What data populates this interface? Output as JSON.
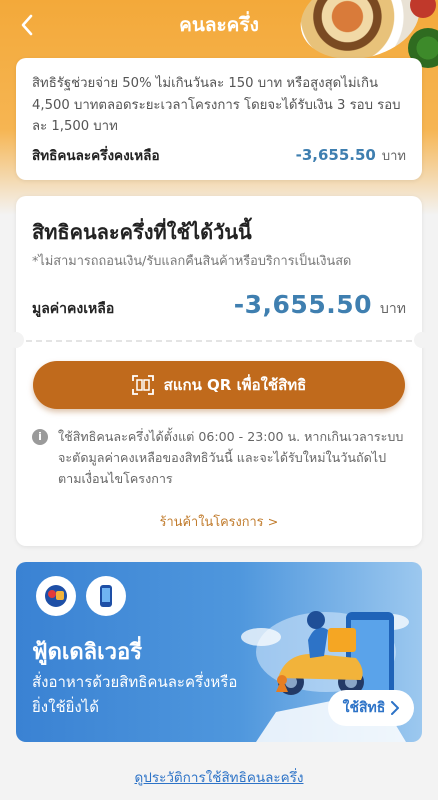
{
  "header": {
    "title": "คนละครึ่ง"
  },
  "info": {
    "description": "สิทธิรัฐช่วยจ่าย 50% ไม่เกินวันละ 150 บาท หรือสูงสุดไม่เกิน 4,500 บาทตลอดระยะเวลาโครงการ โดยจะได้รับเงิน 3 รอบ รอบละ 1,500 บาท",
    "remaining_label": "สิทธิคนละครึ่งคงเหลือ",
    "remaining_value": "-3,655.50",
    "currency": "บาท"
  },
  "today": {
    "title": "สิทธิคนละครึ่งที่ใช้ได้วันนี้",
    "note": "*ไม่สามารถถอนเงิน/รับแลกคืนสินค้าหรือบริการเป็นเงินสด",
    "balance_label": "มูลค่าคงเหลือ",
    "balance_value": "-3,655.50",
    "currency": "บาท",
    "scan_button_label": "สแกน QR เพื่อใช้สิทธิ",
    "notice_text": "ใช้สิทธิคนละครึ่งได้ตั้งแต่ 06:00 - 23:00 น. หากเกินเวลาระบบจะตัดมูลค่าคงเหลือของสิทธิวันนี้ และจะได้รับใหม่ในวันถัดไปตามเงื่อนไขโครงการ",
    "shops_link": "ร้านค้าในโครงการ >"
  },
  "banner": {
    "title": "ฟู้ดเดลิเวอรี่",
    "subtitle": "สั่งอาหารด้วยสิทธิคนละครึ่งหรือยิ่งใช้ยิ่งได้",
    "button_label": "ใช้สิทธิ"
  },
  "footer": {
    "history_link": "ดูประวัติการใช้สิทธิคนละครึ่ง"
  },
  "colors": {
    "header": "#f3a93a",
    "accent_blue": "#3f7fb0",
    "scan_button": "#c06a1c",
    "link_orange": "#c07a2a",
    "banner_blue": "#3a82d3"
  },
  "icons": [
    "back-arrow-icon",
    "qr-scan-icon",
    "info-icon",
    "chevron-right-icon"
  ]
}
